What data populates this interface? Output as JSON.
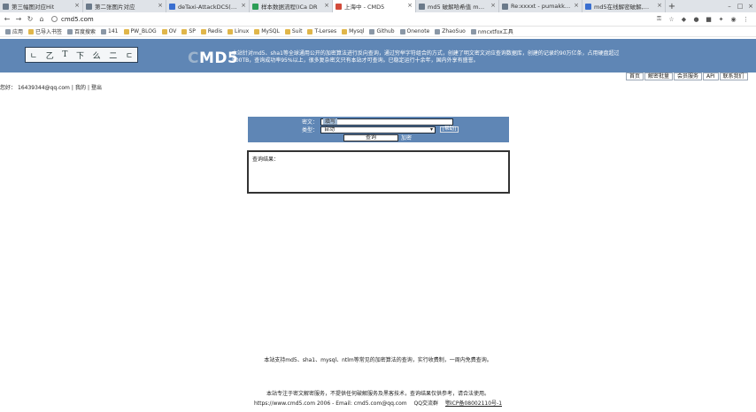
{
  "browser": {
    "tabs": [
      {
        "label": "第三幅图对应Hit"
      },
      {
        "label": "第二张图片对应"
      },
      {
        "label": "deTaxi-AttackDCS(Mp实"
      },
      {
        "label": "样本数据流程(ICa DR"
      },
      {
        "label": "上海中 - CMD5"
      },
      {
        "label": "md5 破解哈希值 md5解"
      },
      {
        "label": "Re:xxxxt - pumakkers/mi"
      },
      {
        "label": "md5在线解密破解,md5解"
      }
    ],
    "new_tab": "+",
    "window_controls": {
      "minimize": "–",
      "maximize": "□",
      "close": "×"
    },
    "address": "cmd5.com",
    "bookmarks": [
      "应用",
      "已导入书签",
      "百度搜索",
      "141",
      "PW_BLOG",
      "OV",
      "SP",
      "Redis",
      "Linux",
      "MySQL",
      "Suit",
      "T-Lerses",
      "Mysql",
      "Github",
      "Onenote",
      "ZhaoSuo",
      "nmcxtfox工具"
    ]
  },
  "site": {
    "logo_text": [
      "ㄴ",
      "乙",
      "T",
      "下",
      "么",
      "二",
      "ㄷ"
    ],
    "brand_prefix": "C",
    "brand_main": "MD5",
    "intro": "本站针对md5、sha1等全球通用公开的加密算法进行反向查询，通过穷举字符组合的方式，创建了明文密文对应查询数据库，创建的记录约90万亿条，占用硬盘超过500TB，查询成功率95%以上，很多复杂密文只有本站才可查询。已稳定运行十余年，国内外享有盛誉。",
    "menu": [
      "首页",
      "解密批量",
      "会员服务",
      "API",
      "联系我们"
    ],
    "user_line": [
      "您好：",
      "16439344@qq.com",
      "|",
      "我的",
      "|",
      "登出"
    ]
  },
  "query": {
    "cipher_label": "密文：",
    "cipher_value": "填写",
    "type_label": "类型：",
    "type_value": "自动",
    "type_option_btn": "[帮助]",
    "submit_label": "查询",
    "encrypt_link": "加密"
  },
  "result": {
    "text": "查询结果："
  },
  "footer": {
    "line1": "本站支持md5、sha1、mysql、ntlm等常见的加密算法的查询，实行收费制，一周内免费查询。",
    "line2": "本站专注于密文解密服务，不提供任何破解服务及黑客技术，查询结果仅供参考，请合法使用。",
    "copyright": "https://www.cmd5.com 2006 - Email: cmd5.com@qq.com",
    "qq": "QQ交流群",
    "icp": "鄂ICP备08002110号-1"
  }
}
